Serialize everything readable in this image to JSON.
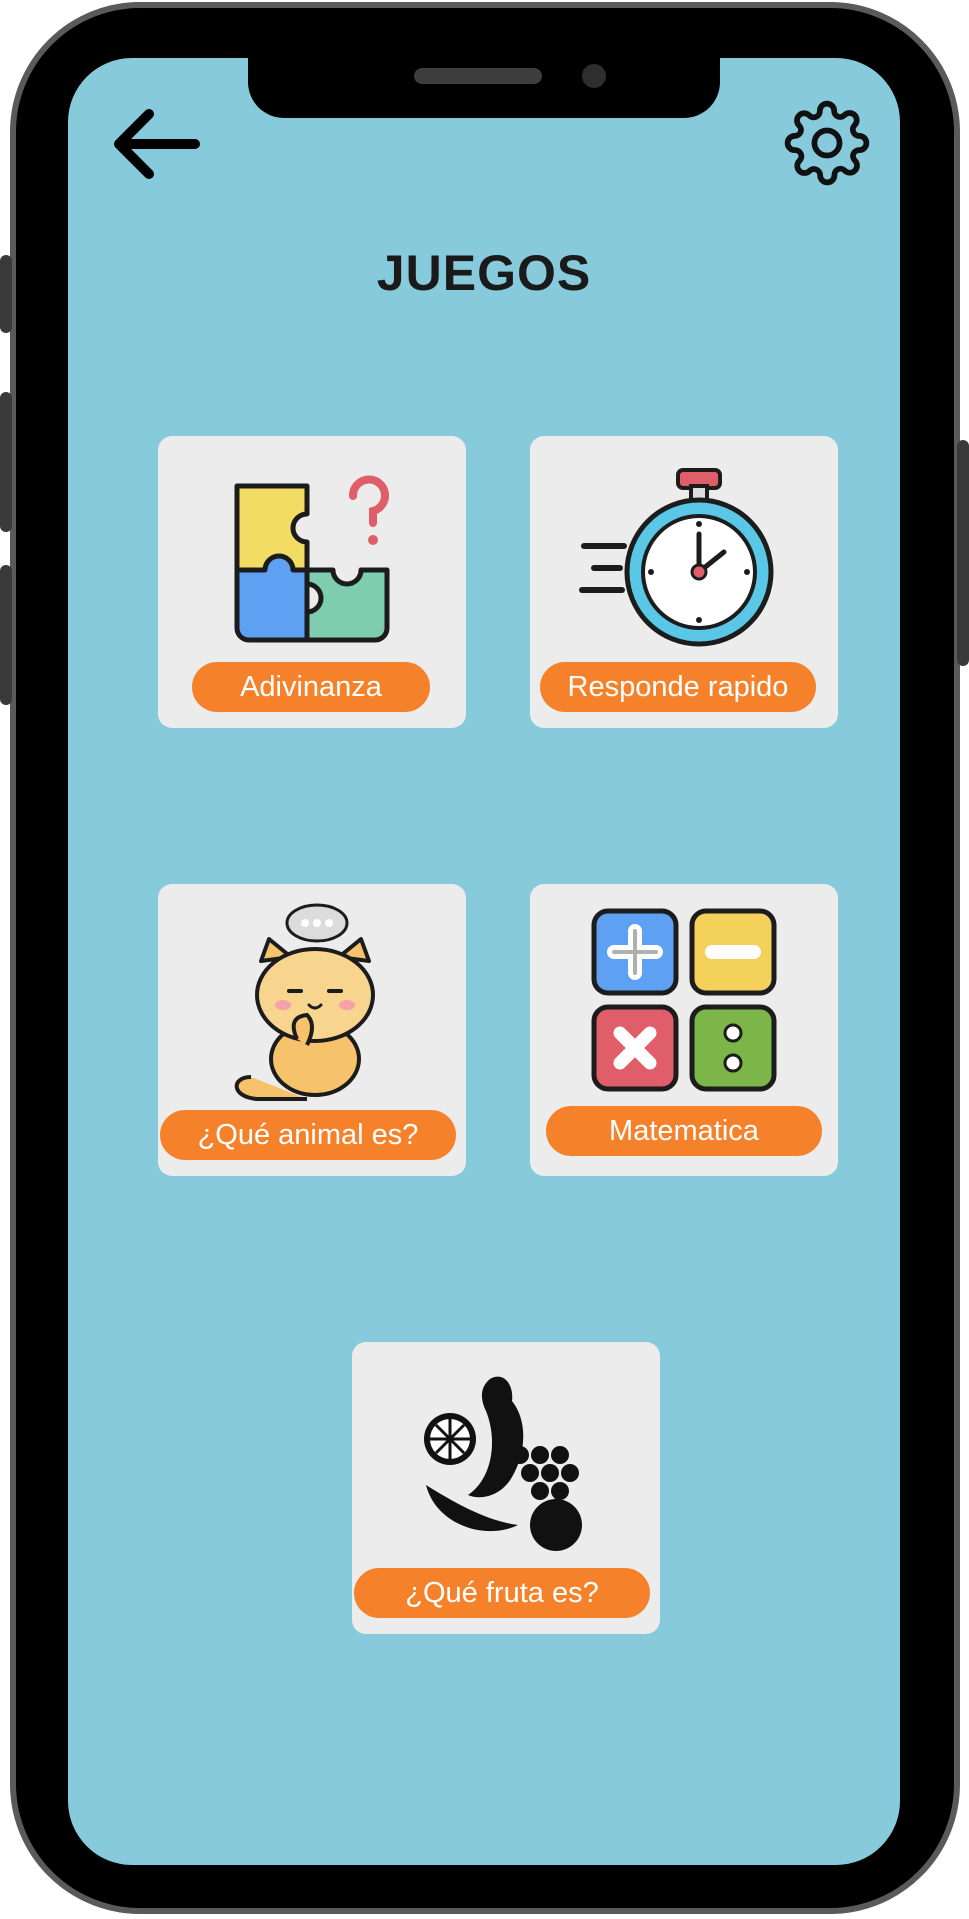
{
  "header": {
    "title": "JUEGOS",
    "back_icon": "arrow-left-icon",
    "settings_icon": "gear-icon"
  },
  "games": [
    {
      "label": "Adivinanza",
      "icon": "puzzle-question-icon"
    },
    {
      "label": "Responde rapido",
      "icon": "stopwatch-icon"
    },
    {
      "label": "¿Qué animal es?",
      "icon": "cat-icon"
    },
    {
      "label": "Matematica",
      "icon": "math-operations-icon"
    },
    {
      "label": "¿Qué fruta es?",
      "icon": "fruits-icon"
    }
  ],
  "colors": {
    "background": "#87cadb",
    "card": "#ececec",
    "pill": "#f5822b",
    "frame": "#000000"
  }
}
